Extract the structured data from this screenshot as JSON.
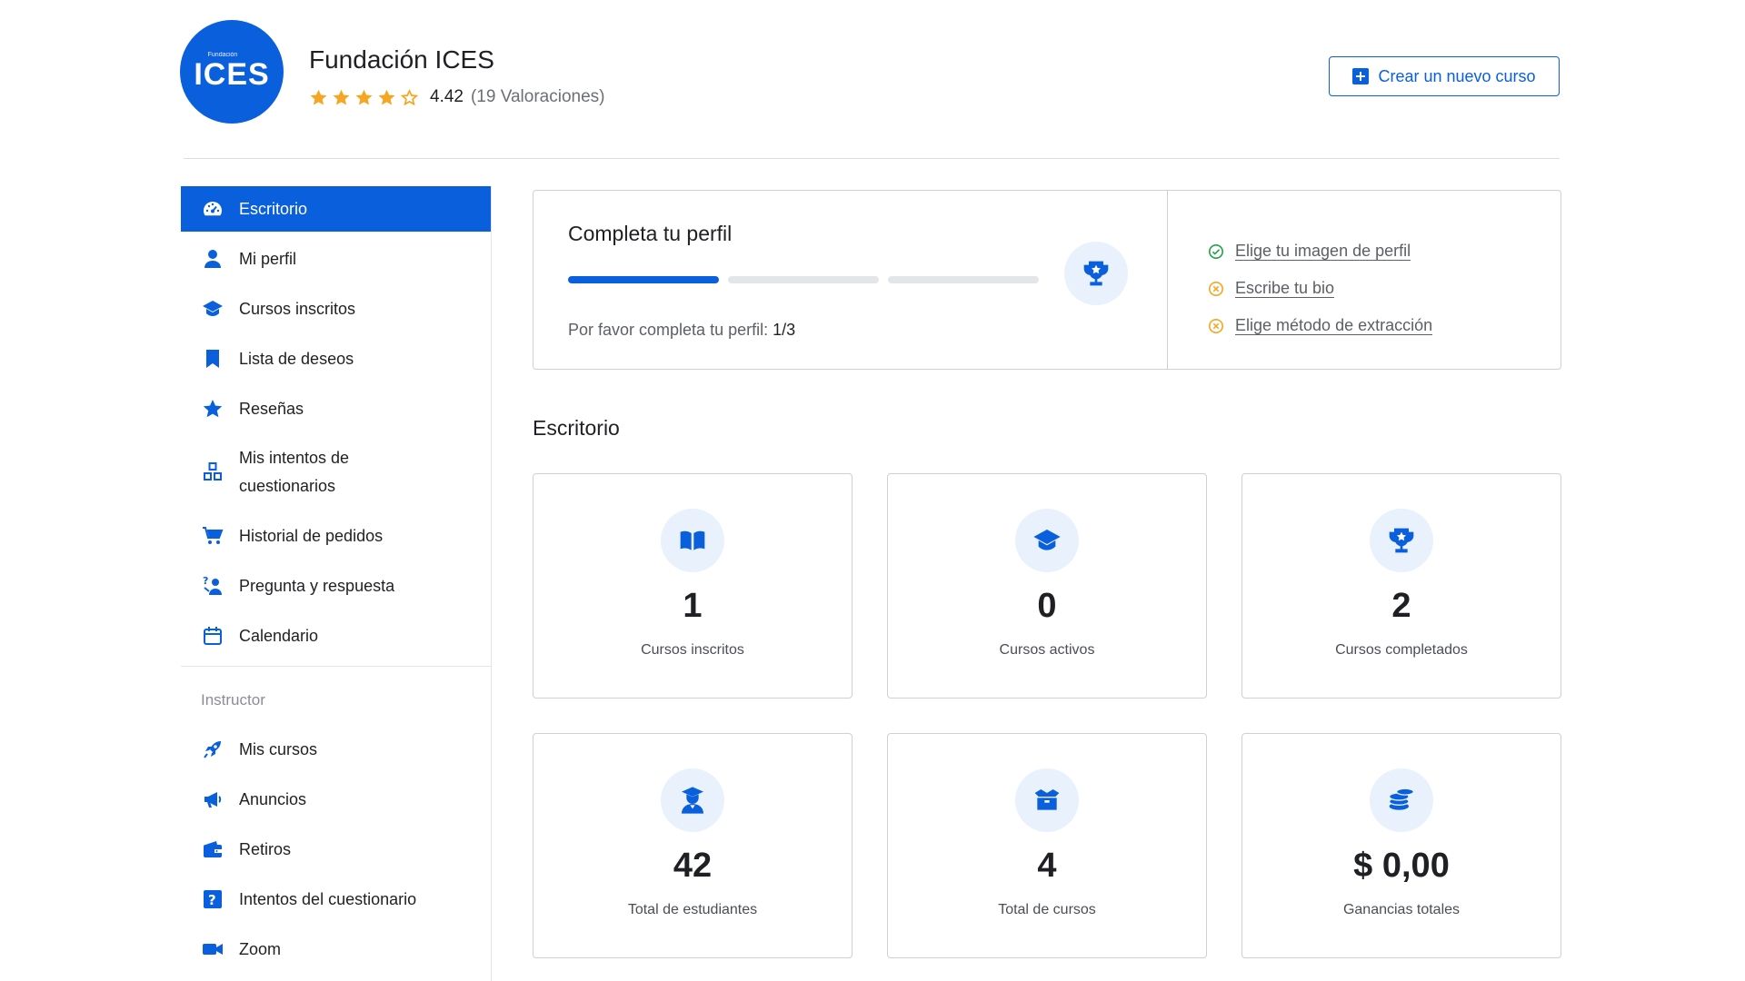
{
  "colors": {
    "primary": "#0a5fdc",
    "star": "#f5a623",
    "success": "#24a148",
    "warning": "#f5a623"
  },
  "header": {
    "logo_small": "Fundación",
    "logo_main": "ICES",
    "org_name": "Fundación ICES",
    "rating_value": "4.42",
    "rating_count": "(19 Valoraciones)",
    "stars": [
      "star-full-icon",
      "star-full-icon",
      "star-full-icon",
      "star-full-icon",
      "star-outline-icon"
    ],
    "create_course_label": "Crear un nuevo curso"
  },
  "sidebar": {
    "items": [
      {
        "label": "Escritorio",
        "icon": "dashboard-icon",
        "active": true
      },
      {
        "label": "Mi perfil",
        "icon": "user-icon"
      },
      {
        "label": "Cursos inscritos",
        "icon": "graduation-cap-icon"
      },
      {
        "label": "Lista de deseos",
        "icon": "bookmark-icon"
      },
      {
        "label": "Reseñas",
        "icon": "star-icon"
      },
      {
        "label": "Mis intentos de cuestionarios",
        "icon": "quiz-blocks-icon"
      },
      {
        "label": "Historial de pedidos",
        "icon": "cart-icon"
      },
      {
        "label": "Pregunta y respuesta",
        "icon": "question-answer-icon"
      },
      {
        "label": "Calendario",
        "icon": "calendar-icon"
      }
    ],
    "instructor_label": "Instructor",
    "instructor_items": [
      {
        "label": "Mis cursos",
        "icon": "rocket-icon"
      },
      {
        "label": "Anuncios",
        "icon": "megaphone-icon"
      },
      {
        "label": "Retiros",
        "icon": "wallet-icon"
      },
      {
        "label": "Intentos del cuestionario",
        "icon": "question-box-icon"
      },
      {
        "label": "Zoom",
        "icon": "video-camera-icon"
      }
    ]
  },
  "profile": {
    "title": "Completa tu perfil",
    "progress": {
      "completed": 1,
      "total": 3
    },
    "note": "Por favor completa tu perfil:",
    "count": "1/3",
    "tasks": [
      {
        "label": "Elige tu imagen de perfil",
        "status": "done"
      },
      {
        "label": "Escribe tu bio",
        "status": "pending"
      },
      {
        "label": "Elige método de extracción",
        "status": "pending"
      }
    ]
  },
  "dashboard": {
    "title": "Escritorio",
    "stats": [
      {
        "value": "1",
        "label": "Cursos inscritos",
        "icon": "open-book-icon"
      },
      {
        "value": "0",
        "label": "Cursos activos",
        "icon": "graduation-cap-icon"
      },
      {
        "value": "2",
        "label": "Cursos completados",
        "icon": "trophy-icon"
      },
      {
        "value": "42",
        "label": "Total de estudiantes",
        "icon": "student-icon"
      },
      {
        "value": "4",
        "label": "Total de cursos",
        "icon": "open-box-icon"
      },
      {
        "value": "$ 0,00",
        "label": "Ganancias totales",
        "icon": "coins-icon"
      }
    ]
  }
}
